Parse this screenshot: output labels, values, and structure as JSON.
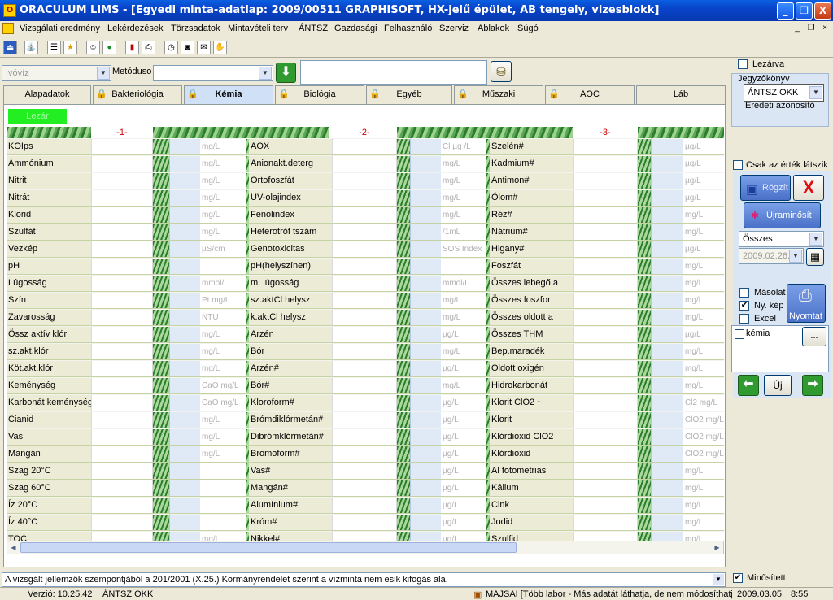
{
  "window": {
    "title": "ORACULUM LIMS - [Egyedi minta-adatlap: 2009/00511 GRAPHISOFT, HX-jelű épület, AB tengely, vizesblokk]",
    "minimize": "_",
    "maximize": "❐",
    "close": "X"
  },
  "menu": [
    "Vizsgálati eredmény",
    "Lekérdezések",
    "Törzsadatok",
    "Mintavételi terv",
    "ÁNTSZ",
    "Gazdasági",
    "Felhasználó",
    "Szerviz",
    "Ablakok",
    "Súgó"
  ],
  "mdi_controls": [
    "_",
    "❐",
    "×"
  ],
  "filter": {
    "sample_type": "Ivóvíz",
    "method_label": "Metóduso",
    "method_value": ""
  },
  "right_panel": {
    "lezarva": "Lezárva",
    "jegyzokonyv_label": "Jegyzőkönyv",
    "jegyzokonyv_value": "ÁNTSZ OKK",
    "eredeti": "Eredeti azonosító",
    "csak_ertek": "Csak az érték látszik",
    "rogzit": "Rögzít",
    "ujraminosit": "Újraminősít",
    "osszes": "Összes",
    "date": "2009.02.26.",
    "masolat": "Másolat",
    "ny_kep": "Ny. kép",
    "excel": "Excel",
    "nyomtat": "Nyomtat",
    "list_item": "kémia",
    "ellipsis": "...",
    "uj": "Új"
  },
  "tabs": [
    "Alapadatok",
    "Bakteriológia",
    "Kémia",
    "Biológia",
    "Egyéb",
    "Műszaki",
    "AOC",
    "Láb"
  ],
  "lezar_button": "Lezár",
  "grid": {
    "col_headers": [
      "-1-",
      "-2-",
      "-3-"
    ],
    "rows": [
      [
        "KOIps",
        "",
        "mg/L",
        "AOX",
        "Cl µg /L",
        "Szelén#",
        "µg/L"
      ],
      [
        "Ammónium",
        "",
        "mg/L",
        "Anionakt.deterg",
        "mg/L",
        "Kadmium#",
        "µg/L"
      ],
      [
        "Nitrit",
        "",
        "mg/L",
        "Ortofoszfát",
        "mg/L",
        "Antimon#",
        "µg/L"
      ],
      [
        "Nitrát",
        "",
        "mg/L",
        "UV-olajindex",
        "mg/L",
        "Ólom#",
        "µg/L"
      ],
      [
        "Klorid",
        "",
        "mg/L",
        "Fenolindex",
        "mg/L",
        "Réz#",
        "mg/L"
      ],
      [
        "Szulfát",
        "",
        "mg/L",
        "Heterotróf tszám",
        "/1mL",
        "Nátrium#",
        "mg/L"
      ],
      [
        "Vezkép",
        "",
        "µS/cm",
        "Genotoxicitas",
        "SOS Index",
        "Higany#",
        "µg/L"
      ],
      [
        "pH",
        "",
        "",
        "pH(helyszínen)",
        "",
        "Foszfát",
        "mg/L"
      ],
      [
        "Lúgosság",
        "",
        "mmol/L",
        "m. lúgosság",
        "mmol/L",
        "Összes lebegő a",
        "mg/L"
      ],
      [
        "Szín",
        "",
        "Pt mg/L",
        "sz.aktCl helysz",
        "mg/L",
        "Összes foszfor",
        "mg/L"
      ],
      [
        "Zavarosság",
        "",
        "NTU",
        "k.aktCl helysz",
        "mg/L",
        "Összes oldott a",
        "mg/L"
      ],
      [
        "Össz aktív klór",
        "",
        "mg/L",
        "Arzén",
        "µg/L",
        "Összes THM",
        "µg/L"
      ],
      [
        "sz.akt.klór",
        "",
        "mg/L",
        "Bór",
        "mg/L",
        "Bep.maradék",
        "mg/L"
      ],
      [
        "Köt.akt.klór",
        "",
        "mg/L",
        "Arzén#",
        "µg/L",
        "Oldott oxigén",
        "mg/L"
      ],
      [
        "Keménység",
        "",
        "CaO mg/L",
        "Bór#",
        "mg/L",
        "Hidrokarbonát",
        "mg/L"
      ],
      [
        "Karbonát keménység",
        "",
        "CaO mg/L",
        "Kloroform#",
        "µg/L",
        "Klorit ClO2 ~",
        "Cl2 mg/L"
      ],
      [
        "Cianid",
        "",
        "mg/L",
        "Brómdiklórmetán#",
        "µg/L",
        "Klorit",
        "ClO2 mg/L"
      ],
      [
        "Vas",
        "",
        "mg/L",
        "Dibrómklórmetán#",
        "µg/L",
        "Klórdioxid ClO2",
        "ClO2 mg/L"
      ],
      [
        "Mangán",
        "",
        "mg/L",
        "Bromoform#",
        "µg/L",
        "Klórdioxid",
        "ClO2 mg/L"
      ],
      [
        "Szag 20°C",
        "",
        "",
        "Vas#",
        "µg/L",
        "Al fotometrias",
        "mg/L"
      ],
      [
        "Szag 60°C",
        "",
        "",
        "Mangán#",
        "µg/L",
        "Kálium",
        "mg/L"
      ],
      [
        "Íz 20°C",
        "",
        "",
        "Alumínium#",
        "µg/L",
        "Cink",
        "mg/L"
      ],
      [
        "Íz 40°C",
        "",
        "",
        "Króm#",
        "µg/L",
        "Jodid",
        "mg/L"
      ],
      [
        "TOC",
        "",
        "mg/L",
        "Nikkel#",
        "µg/L",
        "Szulfid",
        "mg/L"
      ]
    ]
  },
  "bottom_message": "A vizsgált jellemzők szempontjából a 201/2001 (X.25.) Kormányrendelet szerint a vízminta nem esik kifogás alá.",
  "minositett": "Minősített",
  "status": {
    "version": "Verzió: 10.25.42",
    "org": "ÁNTSZ OKK",
    "user": "MAJSAI [Több labor - Más adatát láthatja, de nem módosíthatja]",
    "date": "2009.03.05.",
    "time": "8:55"
  },
  "colors": {
    "title_bar": "#0843c9",
    "lezar_green": "#22ee22",
    "active_tab": "#cfe0f7",
    "header_red": "#cc0000"
  }
}
